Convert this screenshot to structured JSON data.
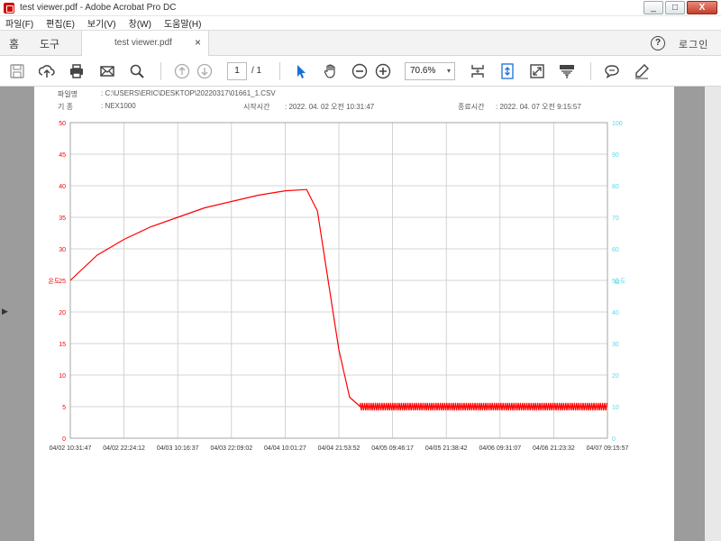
{
  "window": {
    "title": "test viewer.pdf - Adobe Acrobat Pro DC",
    "min": "_",
    "max": "□",
    "close": "X"
  },
  "menu": [
    "파일(F)",
    "편집(E)",
    "보기(V)",
    "창(W)",
    "도움말(H)"
  ],
  "tabs": {
    "home": "홈",
    "tools": "도구",
    "doc": "test viewer.pdf",
    "close": "×",
    "help": "?",
    "login": "로그인"
  },
  "toolbar": {
    "page_current": "1",
    "page_total": "/ 1",
    "zoom": "70.6%",
    "zoom_caret": "▾"
  },
  "header": {
    "file_label": "파일명",
    "file_path": ": C:\\USERS\\ERIC\\DESKTOP\\20220317\\01661_1.CSV",
    "device_label": "기    종",
    "device_value": ": NEX1000",
    "start_label": "시작시간",
    "start_value": ": 2022. 04. 02 오전 10:31:47",
    "end_label": "종료시간",
    "end_value": ": 2022. 04. 07 오전 9:15:57"
  },
  "chart_data": {
    "type": "line",
    "y_left": {
      "ticks": [
        "50",
        "45",
        "40",
        "35",
        "30",
        "25",
        "20",
        "15",
        "10",
        "5",
        "0"
      ],
      "range": [
        0,
        50
      ],
      "label": "온도",
      "color": "#ff0000"
    },
    "y_right": {
      "ticks": [
        "100",
        "90",
        "80",
        "70",
        "60",
        "50",
        "40",
        "30",
        "20",
        "10",
        "0"
      ],
      "range": [
        0,
        100
      ],
      "label": "습도",
      "color": "#5ad8e8"
    },
    "x_ticks": [
      "04/02 10:31:47",
      "04/02 22:24:12",
      "04/03 10:16:37",
      "04/03 22:09:02",
      "04/04 10:01:27",
      "04/04 21:53:52",
      "04/05 09:46:17",
      "04/05 21:38:42",
      "04/06 09:31:07",
      "04/06 21:23:32",
      "04/07 09:15:57"
    ],
    "series": [
      {
        "name": "온도",
        "color": "#ff0000",
        "points": [
          [
            0,
            25
          ],
          [
            0.5,
            29
          ],
          [
            1,
            31.5
          ],
          [
            1.5,
            33.5
          ],
          [
            2,
            35
          ],
          [
            2.5,
            36.5
          ],
          [
            3,
            37.5
          ],
          [
            3.5,
            38.5
          ],
          [
            4,
            39.2
          ],
          [
            4.4,
            39.4
          ],
          [
            4.6,
            36
          ],
          [
            4.8,
            25
          ],
          [
            5,
            14
          ],
          [
            5.2,
            6.5
          ],
          [
            5.4,
            5
          ],
          [
            10,
            5
          ]
        ],
        "noise_from": 5.4,
        "noise_amplitude": 0.6
      }
    ],
    "grid": true
  }
}
